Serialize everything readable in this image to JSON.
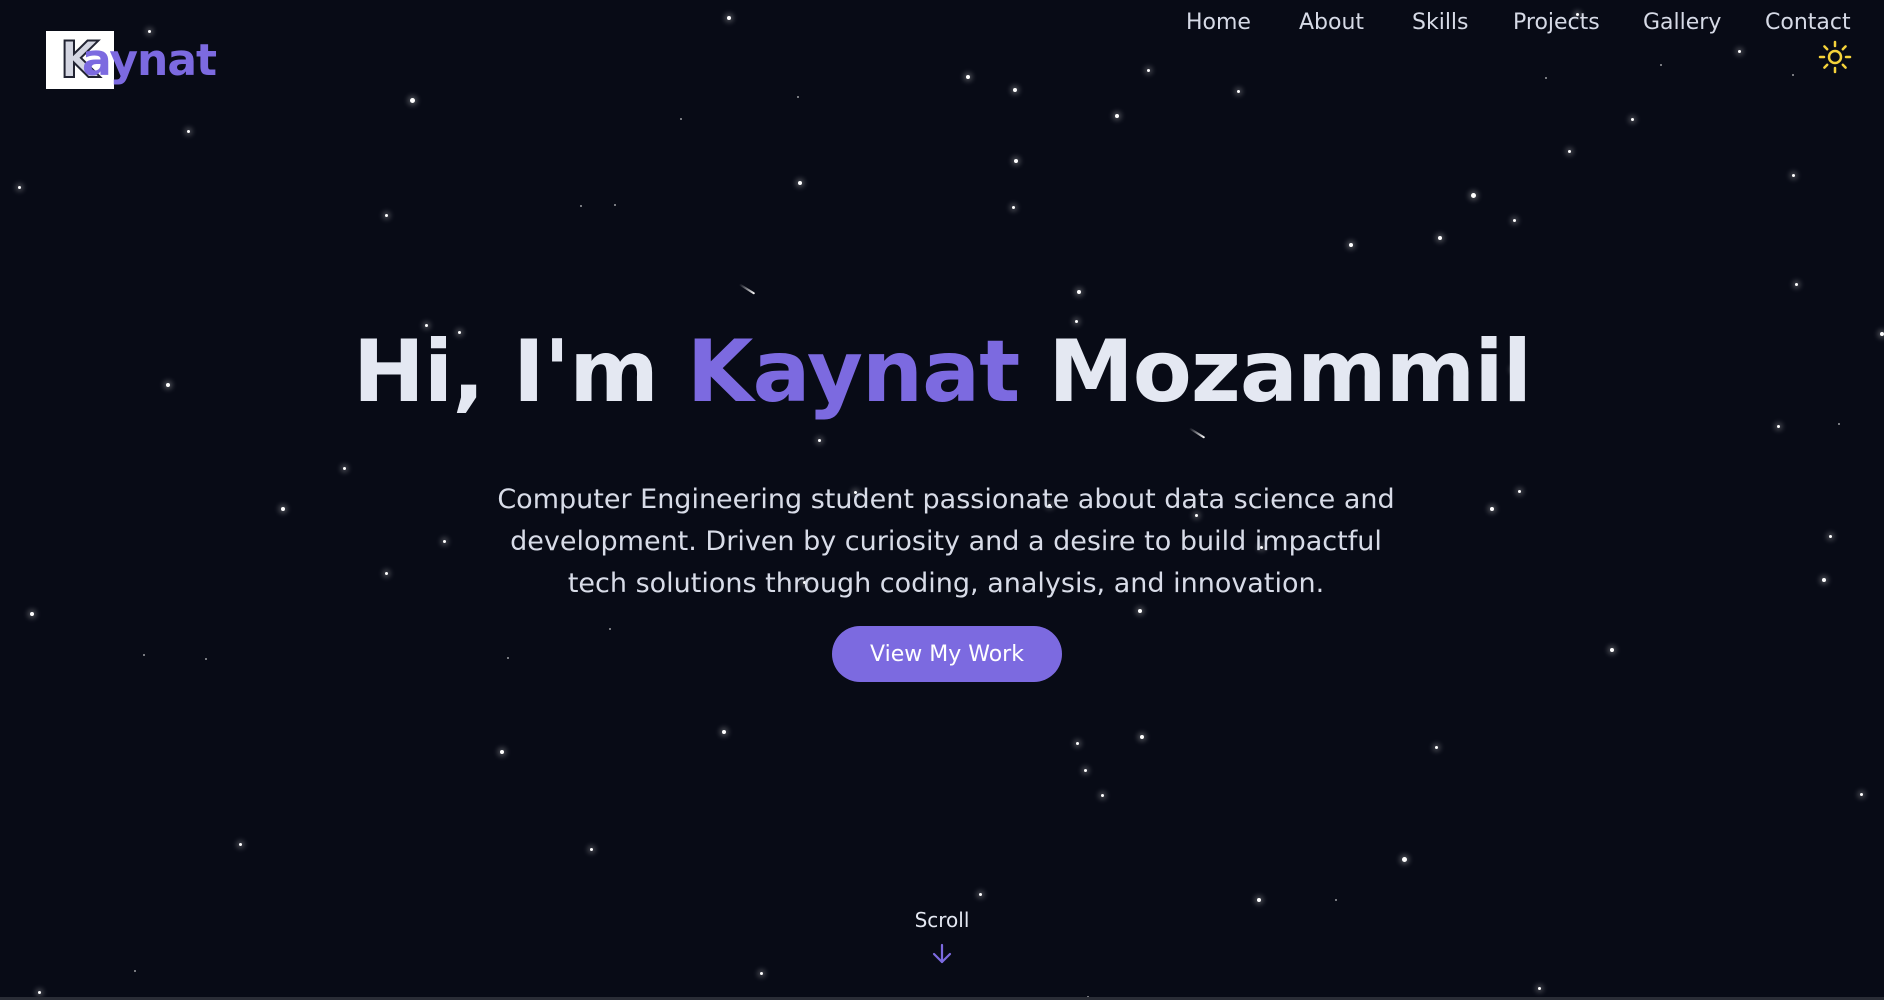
{
  "brand": {
    "logo_initial": "K",
    "logo_text": "aynat"
  },
  "nav": {
    "items": [
      {
        "label": "Home"
      },
      {
        "label": "About"
      },
      {
        "label": "Skills"
      },
      {
        "label": "Projects"
      },
      {
        "label": "Gallery"
      },
      {
        "label": "Contact"
      }
    ],
    "theme_toggle_icon": "sun-icon"
  },
  "hero": {
    "greeting": "Hi, I'm",
    "first_name": "Kaynat",
    "last_name": "Mozammil",
    "description": "Computer Engineering student passionate about data science and development. Driven by curiosity and a desire to build impactful tech solutions through coding, analysis, and innovation.",
    "cta_label": "View My Work",
    "scroll_label": "Scroll",
    "scroll_icon": "arrow-down-icon"
  },
  "colors": {
    "background": "#080b16",
    "accent": "#7c6ae0",
    "text": "#e4e8f2",
    "sun": "#f5d33a"
  }
}
